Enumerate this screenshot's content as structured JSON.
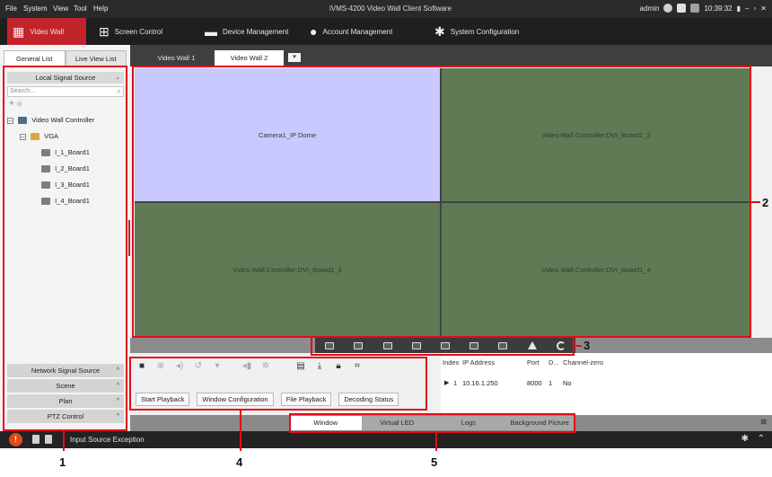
{
  "menubar": {
    "items": [
      "File",
      "System",
      "View",
      "Tool",
      "Help"
    ],
    "title": "iVMS-4200 Video Wall Client Software",
    "user": "admin",
    "time": "10:39:32"
  },
  "modules": [
    {
      "label": "Video Wall"
    },
    {
      "label": "Screen Control"
    },
    {
      "label": "Device Management"
    },
    {
      "label": "Account Management"
    },
    {
      "label": "System Configuration"
    }
  ],
  "left": {
    "tabs": [
      "General List",
      "Live View List"
    ],
    "source_header": "Local Signal Source",
    "search_placeholder": "Search...",
    "tree": {
      "controller": "Video Wall Controller",
      "group": "VGA",
      "boards": [
        "I_1_Board1",
        "I_2_Board1",
        "I_3_Board1",
        "I_4_Board1"
      ]
    },
    "sections": [
      "Network Signal Source",
      "Scene",
      "Plan",
      "PTZ Control"
    ]
  },
  "wall_tabs": [
    "Video Wall 1",
    "Video Wall 2"
  ],
  "cells": [
    "Camera1_IP Dome",
    "Video Wall Controller:DVI_Board1_2",
    "Video Wall Controller:DVI_Board1_3",
    "Video Wall Controller:DVI_Board1_4"
  ],
  "control": {
    "buttons": [
      "Start Playback",
      "Window Configuration",
      "File Playback",
      "Decoding Status"
    ]
  },
  "table": {
    "headers": [
      "Index",
      "IP Address",
      "Port",
      "D...",
      "Channel-zero"
    ],
    "rows": [
      [
        "1",
        "10.16.1.250",
        "8000",
        "1",
        "No"
      ]
    ]
  },
  "bottom_tabs": [
    "Window",
    "Virtual LED",
    "Logs",
    "Background Picture"
  ],
  "status_message": "Input Source Exception",
  "callouts": [
    "1",
    "2",
    "3",
    "4",
    "5"
  ],
  "colors": {
    "accent": "#c2242b",
    "annotation": "#e30c18",
    "selected_cell": "#c9c9ff",
    "cell": "#5f7a54"
  }
}
